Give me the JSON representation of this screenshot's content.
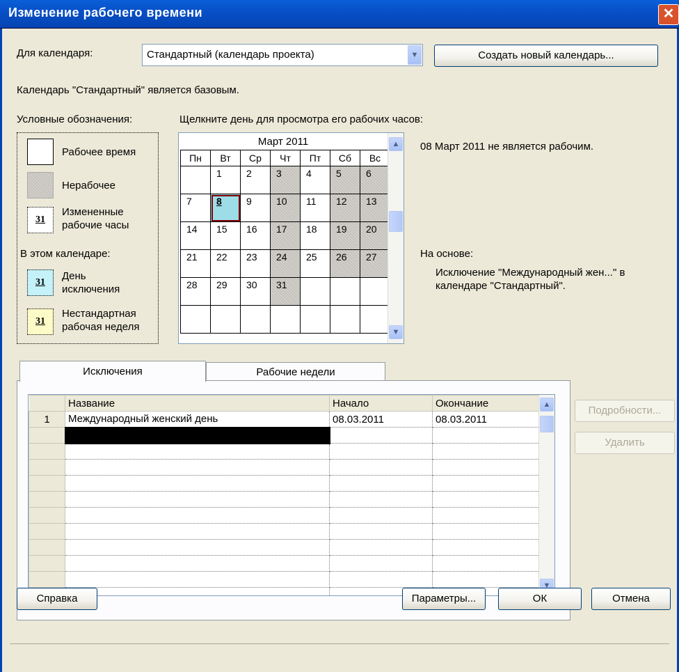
{
  "window": {
    "title": "Изменение рабочего времени",
    "close": "✕"
  },
  "calendar_select": {
    "label": "Для календаря:",
    "value": "Стандартный (календарь проекта)",
    "create_button": "Создать новый календарь..."
  },
  "base_note": "Календарь \"Стандартный\" является базовым.",
  "legend": {
    "title": "Условные обозначения:",
    "working": "Рабочее время",
    "nonworking": "Нерабочее",
    "changed": "Измененные рабочие часы",
    "changed_day": "31",
    "in_calendar": "В этом календаре:",
    "exception": "День исключения",
    "exception_day": "31",
    "nonstandard": "Нестандартная рабочая неделя",
    "nonstandard_day": "31"
  },
  "click_hint": "Щелкните день для просмотра его рабочих часов:",
  "month": {
    "title": "Март 2011",
    "weekdays": [
      "Пн",
      "Вт",
      "Ср",
      "Чт",
      "Пт",
      "Сб",
      "Вс"
    ],
    "rows": [
      [
        "",
        "1",
        "2",
        "3",
        "4",
        "5",
        "6"
      ],
      [
        "7",
        "8",
        "9",
        "10",
        "11",
        "12",
        "13"
      ],
      [
        "14",
        "15",
        "16",
        "17",
        "18",
        "19",
        "20"
      ],
      [
        "21",
        "22",
        "23",
        "24",
        "25",
        "26",
        "27"
      ],
      [
        "28",
        "29",
        "30",
        "31",
        "",
        "",
        ""
      ],
      [
        "",
        "",
        "",
        "",
        "",
        "",
        ""
      ]
    ],
    "selected_day": "8"
  },
  "info": {
    "status": "08 Март 2011 не является рабочим.",
    "based_on_label": "На основе:",
    "based_on_text": "Исключение \"Международный жен...\" в календаре \"Стандартный\"."
  },
  "tabs": [
    "Исключения",
    "Рабочие недели"
  ],
  "exceptions": {
    "columns": [
      "Название",
      "Начало",
      "Окончание"
    ],
    "rows": [
      {
        "n": "1",
        "name": "Международный женский день",
        "start": "08.03.2011",
        "end": "08.03.2011"
      }
    ]
  },
  "side_buttons": {
    "details": "Подробности...",
    "delete": "Удалить"
  },
  "bottom_buttons": {
    "help": "Справка",
    "options": "Параметры...",
    "ok": "ОК",
    "cancel": "Отмена"
  }
}
